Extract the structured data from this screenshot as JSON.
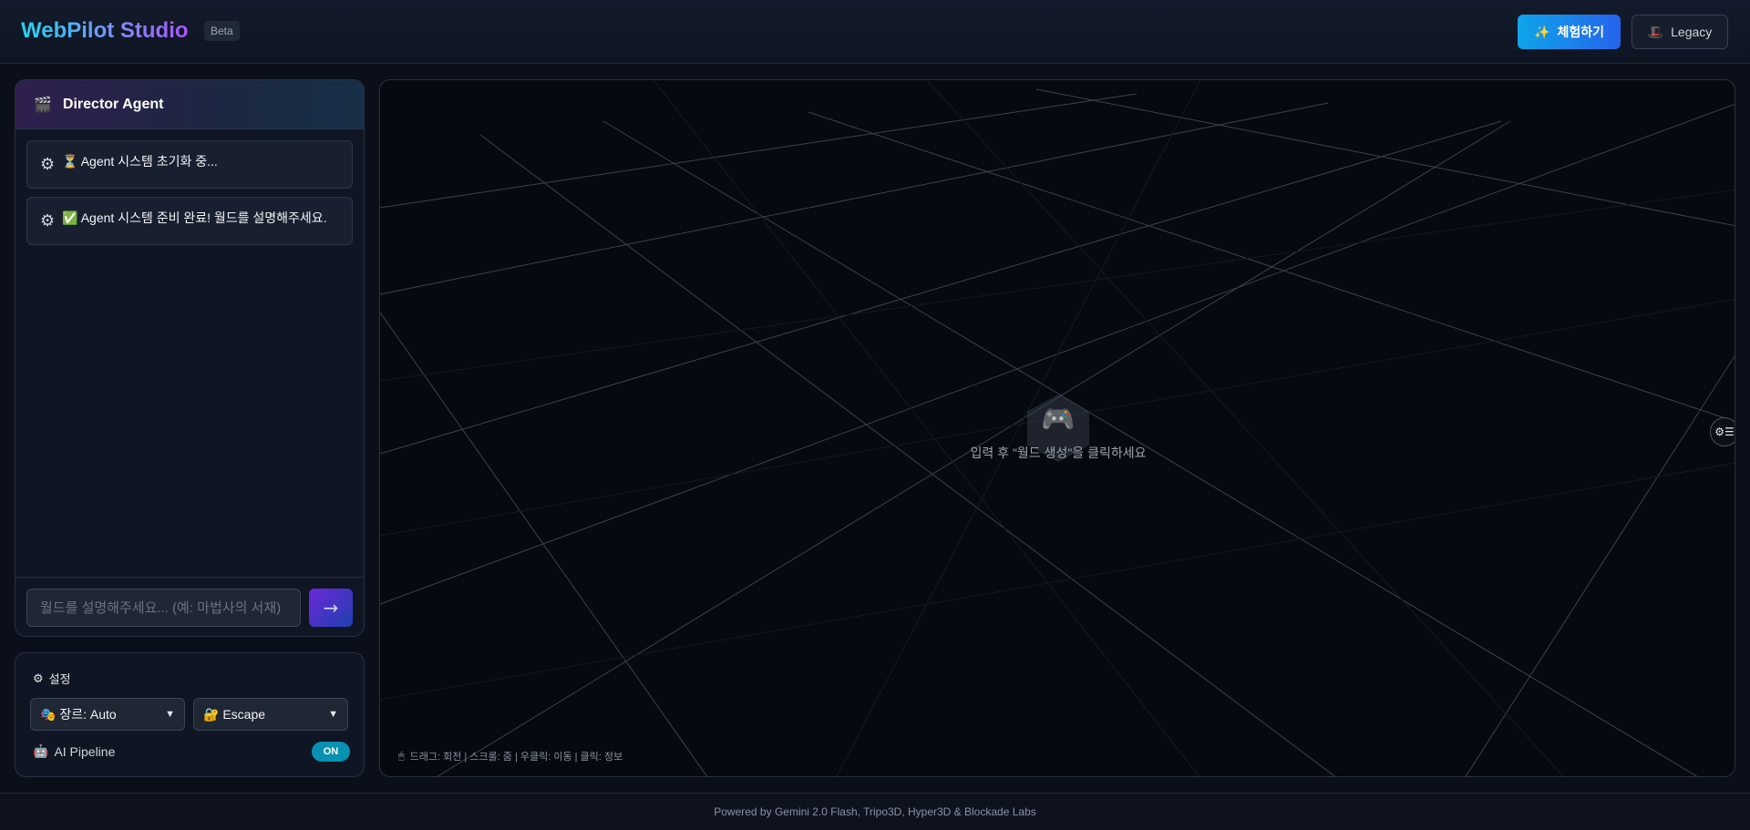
{
  "header": {
    "brand": "WebPilot Studio",
    "badge": "Beta",
    "try_button": {
      "icon": "sparkles-icon",
      "icon_glyph": "✨",
      "label": "체험하기"
    },
    "legacy_button": {
      "icon": "top-hat-icon",
      "icon_glyph": "🎩",
      "label": "Legacy"
    }
  },
  "agent": {
    "icon_glyph": "🎬",
    "title": "Director Agent",
    "messages": [
      {
        "icon_glyph": "⚙",
        "text": "⏳ Agent 시스템 초기화 중..."
      },
      {
        "icon_glyph": "⚙",
        "text": "✅ Agent 시스템 준비 완료! 월드를 설명해주세요."
      }
    ],
    "input": {
      "placeholder": "월드를 설명해주세요... (예: 마법사의 서재)",
      "value": ""
    },
    "send_glyph": "→"
  },
  "settings": {
    "icon_glyph": "⚙",
    "title": "설정",
    "genre_select": {
      "icon_glyph": "🎭",
      "value": "장르: Auto"
    },
    "mode_select": {
      "icon_glyph": "🔐",
      "value": "Escape"
    },
    "pipeline": {
      "icon_glyph": "🤖",
      "label": "AI Pipeline",
      "toggle": "ON"
    }
  },
  "viewport": {
    "empty_icon_glyph": "🎮",
    "empty_text": "입력 후 \"월드 생성\"을 클릭하세요",
    "hint_icon_glyph": "🖱",
    "hint": "드래그: 회전 | 스크롤: 줌 | 우클릭: 이동 | 클릭: 정보",
    "side_button_glyph": "⚙☰"
  },
  "footer": {
    "text": "Powered by Gemini 2.0 Flash, Tripo3D, Hyper3D & Blockade Labs"
  },
  "colors": {
    "accent_cyan": "#22d3ee",
    "accent_purple": "#a855f7",
    "toggle_on": "#0891b2",
    "background": "#0b0f1a"
  }
}
